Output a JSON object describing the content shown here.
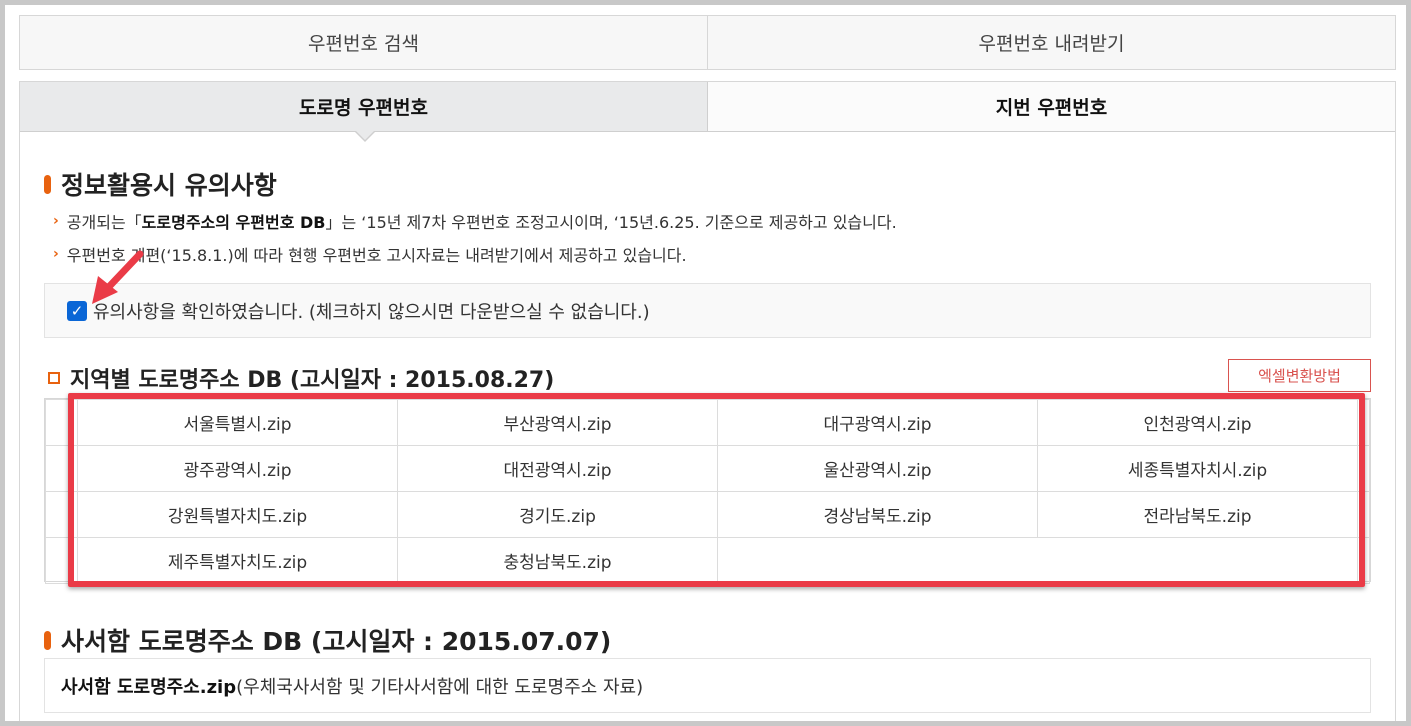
{
  "top_tabs": [
    "우편번호 검색",
    "우편번호 내려받기"
  ],
  "sub_tabs": [
    "도로명 우편번호",
    "지번 우편번호"
  ],
  "notice": {
    "title": "정보활용시 유의사항",
    "line1_prefix": "공개되는「",
    "line1_bold": "도로명주소의 우편번호 DB",
    "line1_suffix": "」는 ‘15년 제7차 우편번호 조정고시이며, ‘15년.6.25. 기준으로 제공하고 있습니다.",
    "line2": "우편번호 개편(‘15.8.1.)에 따라 현행 우편번호 고시자료는 내려받기에서 제공하고 있습니다."
  },
  "confirm": {
    "label": "유의사항을 확인하였습니다. (체크하지 않으시면 다운받으실 수 없습니다.)",
    "checked": true
  },
  "regional": {
    "title": "지역별 도로명주소 DB (고시일자 : 2015.08.27)",
    "excel_button": "엑셀변환방법",
    "files": [
      [
        "서울특별시.zip",
        "부산광역시.zip",
        "대구광역시.zip",
        "인천광역시.zip"
      ],
      [
        "광주광역시.zip",
        "대전광역시.zip",
        "울산광역시.zip",
        "세종특별자치시.zip"
      ],
      [
        "강원특별자치도.zip",
        "경기도.zip",
        "경상남북도.zip",
        "전라남북도.zip"
      ],
      [
        "제주특별자치도.zip",
        "충청남북도.zip",
        "",
        ""
      ]
    ]
  },
  "pobox": {
    "title": "사서함 도로명주소 DB (고시일자 : 2015.07.07)",
    "file_bold": "사서함 도로명주소.zip",
    "file_desc": "(우체국사서함 및 기타사서함에 대한 도로명주소 자료)"
  },
  "colors": {
    "accent": "#e8620f",
    "highlight": "#ea3b47",
    "checkbox": "#0a66d6"
  }
}
